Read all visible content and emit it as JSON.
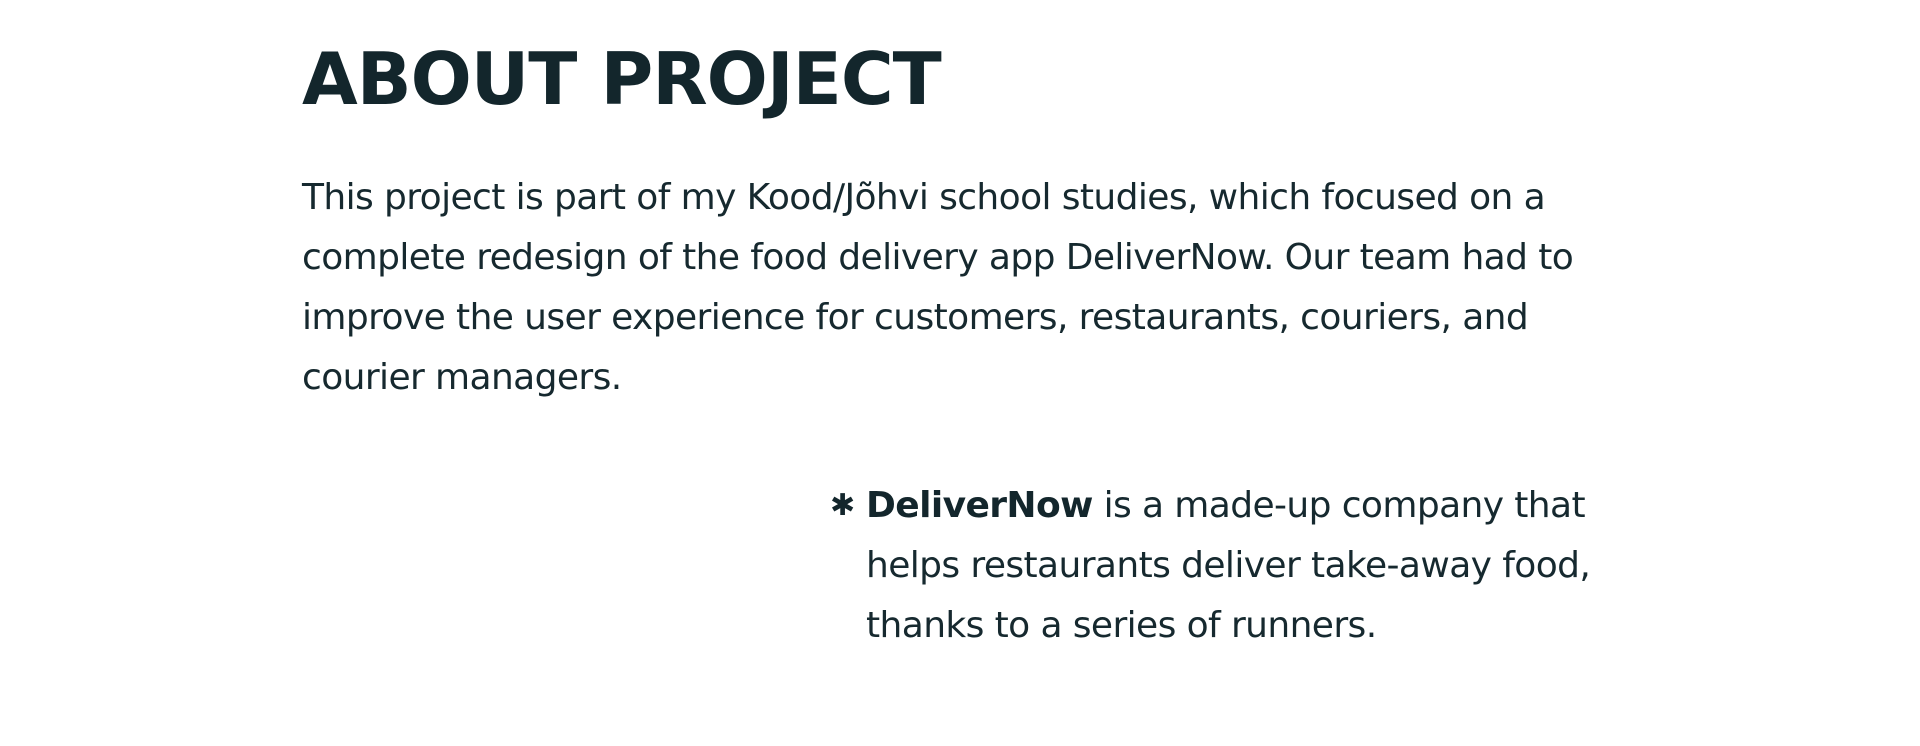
{
  "about": {
    "title": "ABOUT PROJECT",
    "intro": "This project is part of my Kood/Jõhvi school studies, which focused on a complete redesign of the food delivery app DeliverNow. Our team had to improve the user experience for customers, restaurants, couriers, and courier managers.",
    "note": {
      "icon": "asterisk-icon",
      "icon_glyph": "✱",
      "brand": "DeliverNow",
      "text": " is a made-up company that helps restaurants deliver take-away food, thanks to a series of runners."
    }
  },
  "colors": {
    "background": "#ffffff",
    "text": "#16292f",
    "heading": "#13262c"
  }
}
